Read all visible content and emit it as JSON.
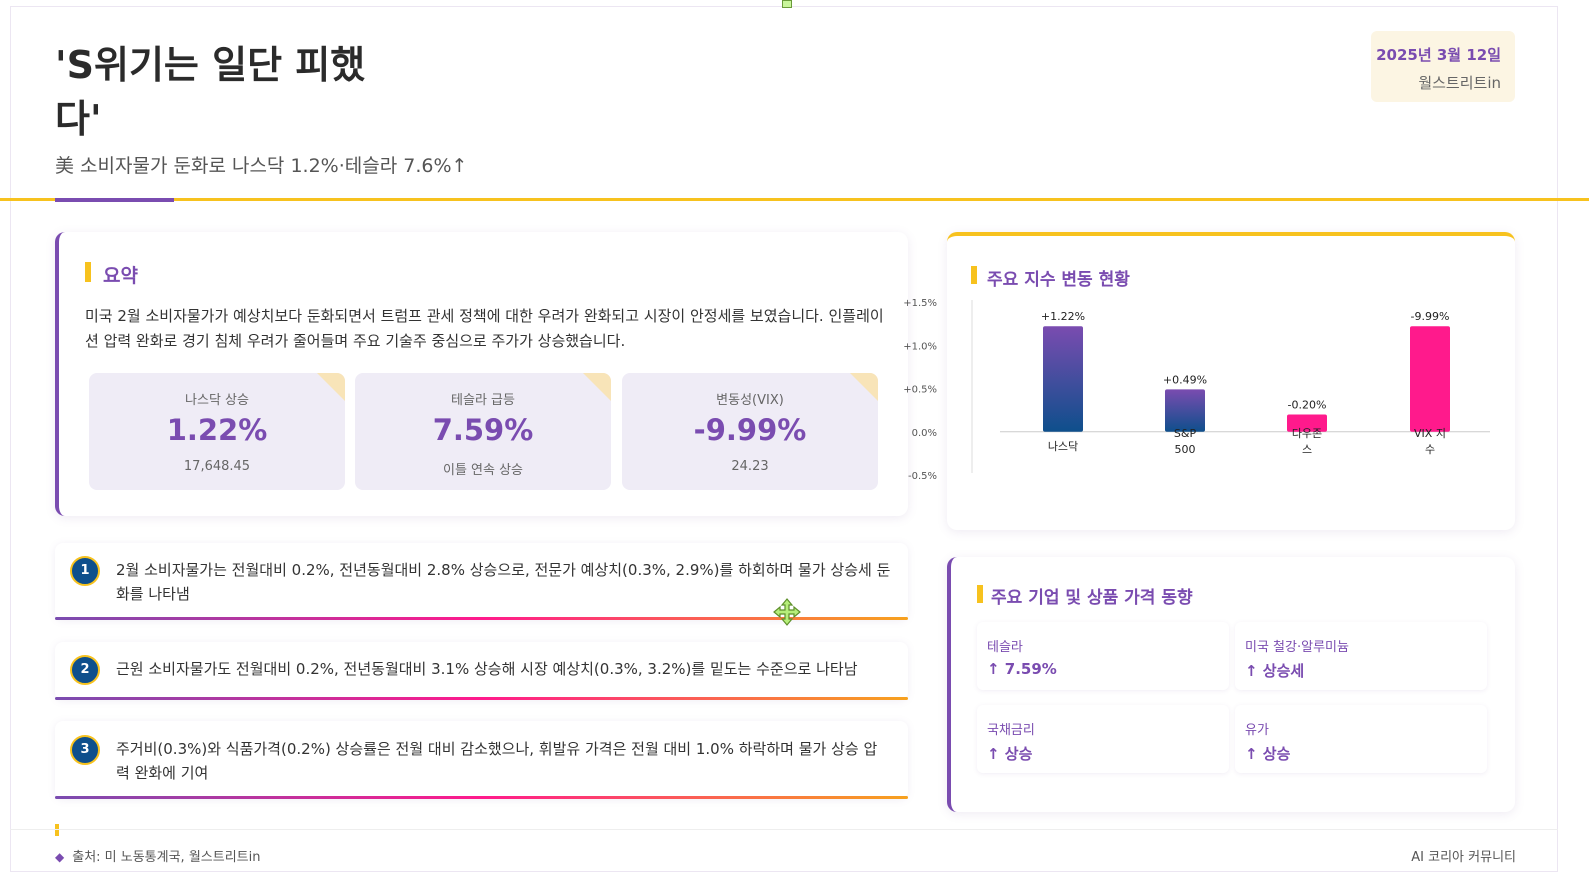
{
  "header": {
    "title": "'S위기는 일단 피했다'",
    "subtitle": "美 소비자물가 둔화로 나스닥 1.2%·테슬라 7.6%↑",
    "date": "2025년 3월 12일",
    "source_name": "월스트리트in"
  },
  "summary": {
    "heading": "요약",
    "text": "미국 2월 소비자물가가 예상치보다 둔화되면서 트럼프 관세 정책에 대한 우려가 완화되고 시장이 안정세를 보였습니다. 인플레이션 압력 완화로 경기 침체 우려가 줄어들며 주요 기술주 중심으로 주가가 상승했습니다.",
    "stats": [
      {
        "label": "나스닥 상승",
        "value": "1.22%",
        "sub": "17,648.45"
      },
      {
        "label": "테슬라 급등",
        "value": "7.59%",
        "sub": "이틀 연속 상승"
      },
      {
        "label": "변동성(VIX)",
        "value": "-9.99%",
        "sub": "24.23"
      }
    ]
  },
  "points": [
    {
      "num": "1",
      "text": "2월 소비자물가는 전월대비 0.2%, 전년동월대비 2.8% 상승으로, 전문가 예상치(0.3%, 2.9%)를 하회하며 물가 상승세 둔화를 나타냄"
    },
    {
      "num": "2",
      "text": "근원 소비자물가도 전월대비 0.2%, 전년동월대비 3.1% 상승해 시장 예상치(0.3%, 3.2%)를 밑도는 수준으로 나타남"
    },
    {
      "num": "3",
      "text": "주거비(0.3%)와 식품가격(0.2%) 상승률은 전월 대비 감소했으나, 휘발유 가격은 전월 대비 1.0% 하락하며 물가 상승 압력 완화에 기여"
    }
  ],
  "chart_card": {
    "heading": "주요 지수 변동 현황"
  },
  "chart_data": {
    "type": "bar",
    "categories": [
      "나스닥",
      "S&P 500",
      "다우존스",
      "VIX 지수"
    ],
    "category_lines": [
      [
        "나스닥"
      ],
      [
        "S&P",
        "500"
      ],
      [
        "다우존",
        "스"
      ],
      [
        "VIX 지",
        "수"
      ]
    ],
    "values": [
      1.22,
      0.49,
      -0.2,
      -9.99
    ],
    "value_labels": [
      "+1.22%",
      "+0.49%",
      "-0.20%",
      "-9.99%"
    ],
    "yticks": [
      "+1.5%",
      "+1.0%",
      "+0.5%",
      "0.0%",
      "-0.5%"
    ],
    "ylim": [
      -0.5,
      1.5
    ],
    "colors": {
      "positive_top": "#7a4cb0",
      "positive_bottom": "#0e4f8c",
      "negative": "#ff1a8c"
    }
  },
  "prices": {
    "heading": "주요 기업 및 상품 가격 동향",
    "items": [
      {
        "label": "테슬라",
        "value": "↑ 7.59%"
      },
      {
        "label": "미국 철강·알루미늄",
        "value": "↑ 상승세"
      },
      {
        "label": "국채금리",
        "value": "↑ 상승"
      },
      {
        "label": "유가",
        "value": "↑ 상승"
      }
    ]
  },
  "footer": {
    "source": "출처: 미 노동통계국, 월스트리트in",
    "community": "AI 코리아 커뮤니티"
  },
  "colors": {
    "accent": "#7a4cb0",
    "highlight": "#f7c21e",
    "negative": "#ff1a8c",
    "navy": "#0e4f8c"
  }
}
